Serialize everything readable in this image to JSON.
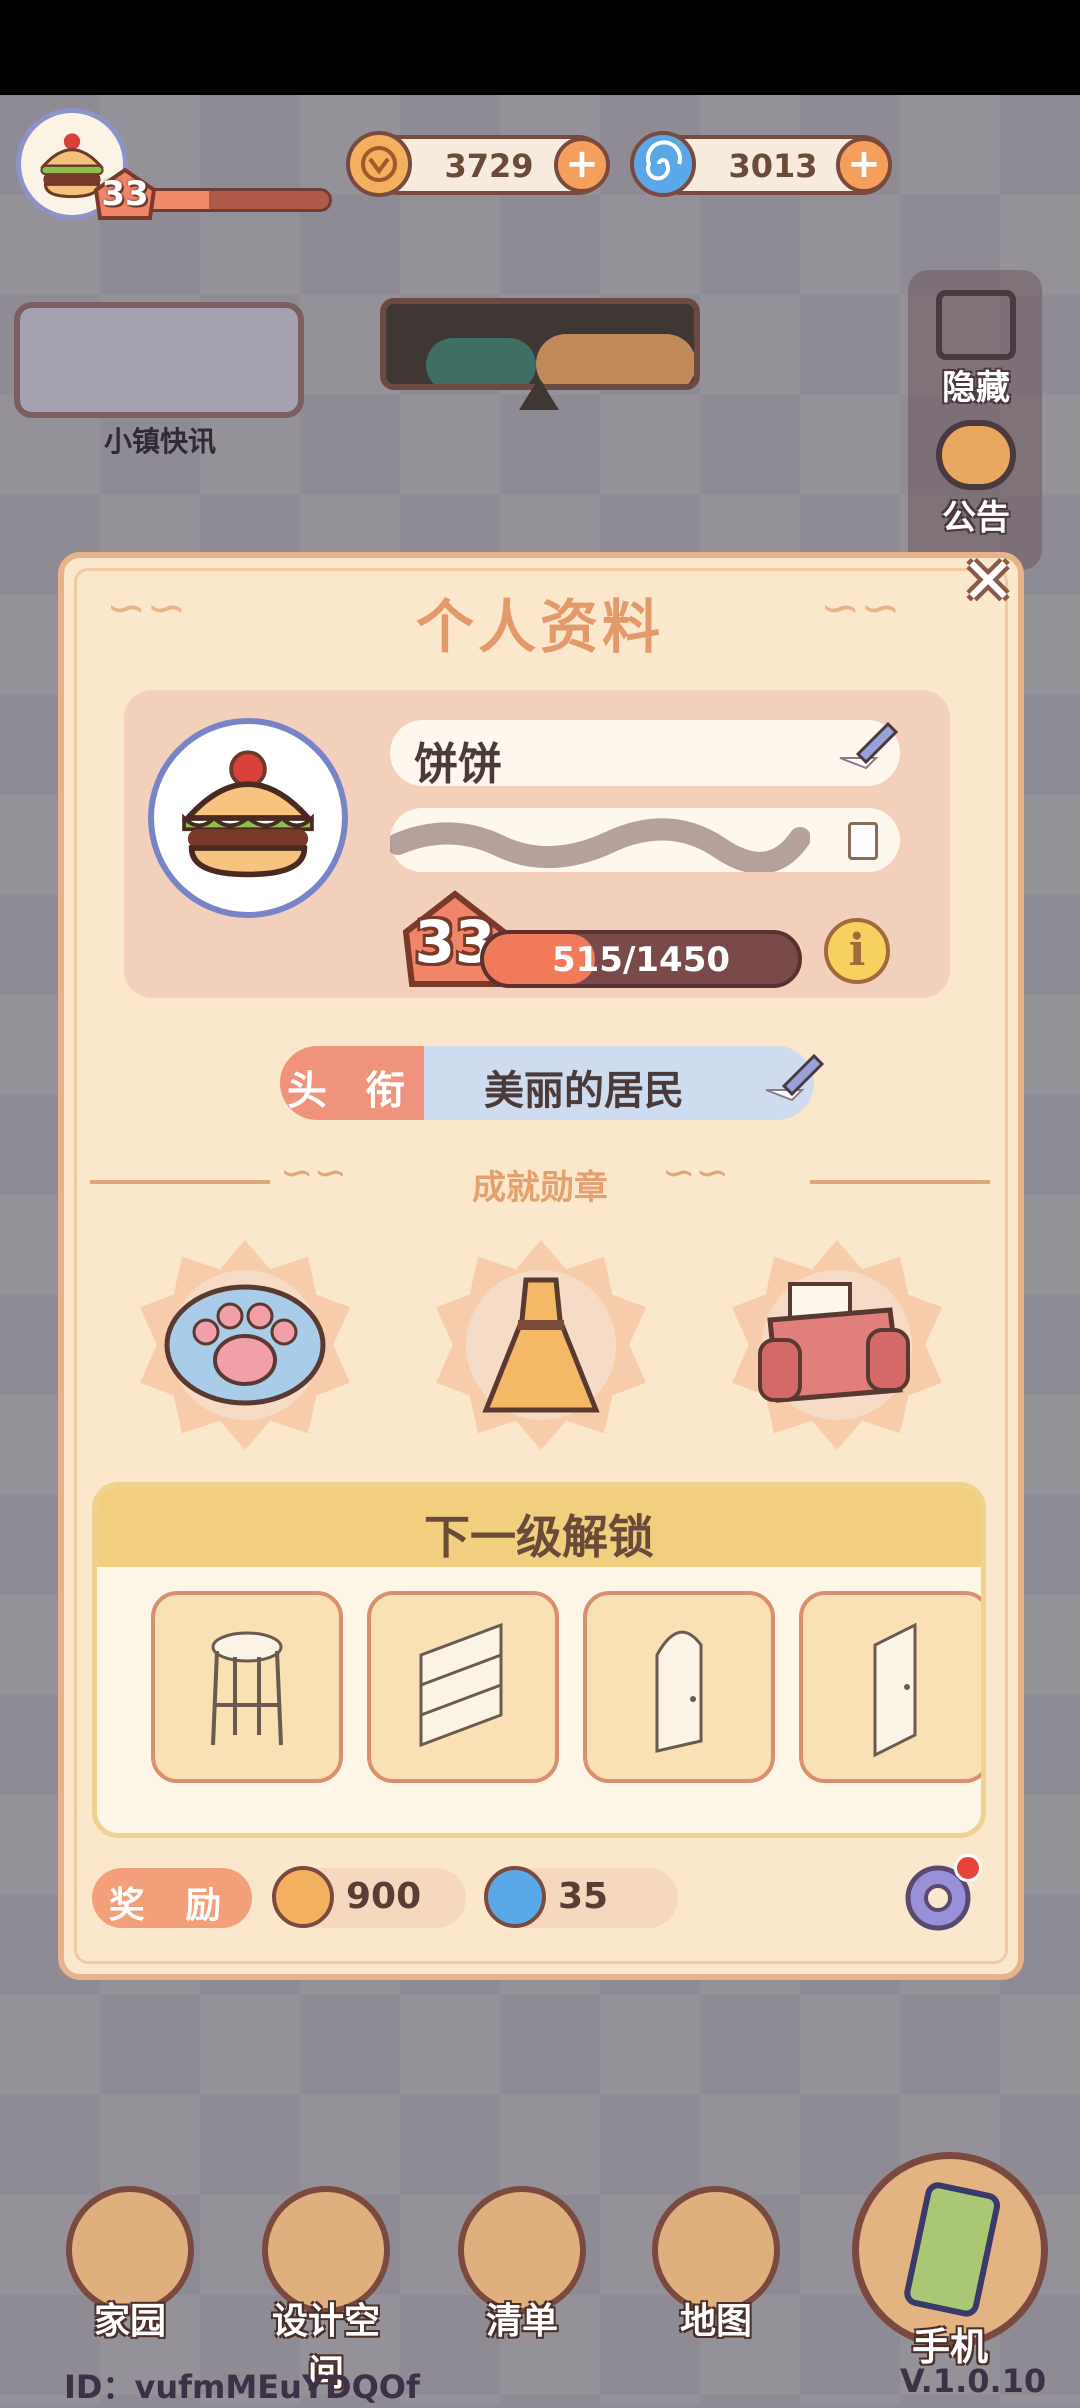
{
  "hud": {
    "level": "33",
    "level_progress": 0.35,
    "coins": "3729",
    "gems": "3013"
  },
  "sidebar": {
    "news_label": "小镇快讯",
    "hide_label": "隐藏",
    "announce_label": "公告"
  },
  "dialog": {
    "title": "个人资料",
    "close_icon": "close-icon",
    "name": "饼饼",
    "level": "33",
    "xp_text": "515/1450",
    "xp_fraction": 0.355,
    "title_tag": "头 衔",
    "title_value": "美丽的居民",
    "achievements_label": "成就勋章",
    "achievements": [
      "paw-medal-icon",
      "dress-medal-icon",
      "armchair-medal-icon"
    ],
    "unlock_header": "下一级解锁",
    "unlock_items": [
      "stool-icon",
      "shelf-icon",
      "arched-door-icon",
      "door-icon"
    ],
    "reward_label": "奖 励",
    "reward_coins": "900",
    "reward_gems": "35"
  },
  "nav": {
    "home": "家园",
    "design": "设计空间",
    "list": "清单",
    "map": "地图",
    "phone": "手机"
  },
  "footer": {
    "id_text": "ID：vufmMEuYDQOf",
    "version": "V.1.0.10"
  },
  "colors": {
    "dialog_bg": "#fbe7cc",
    "accent": "#e29a6a",
    "xp_fill": "#f07a5a"
  }
}
